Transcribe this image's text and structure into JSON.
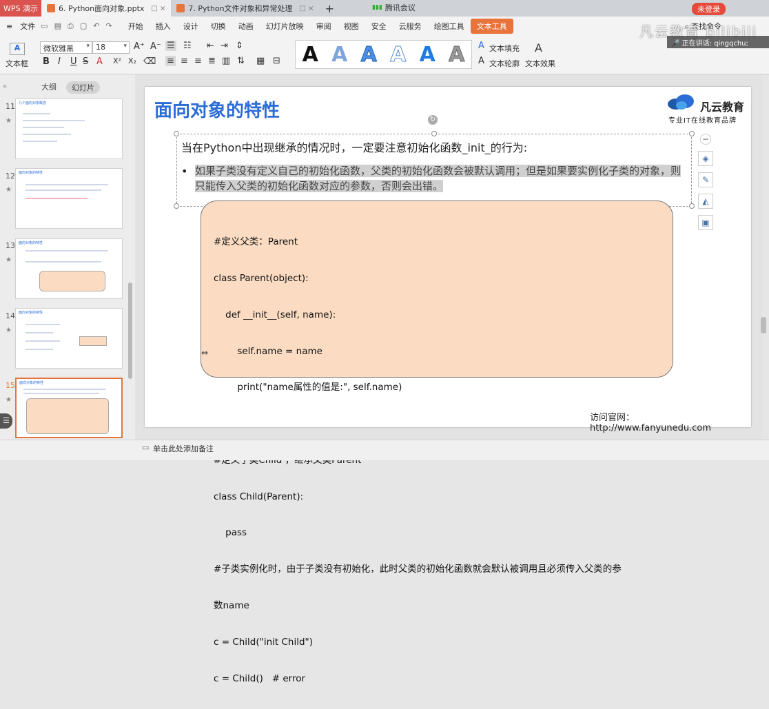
{
  "titlebar": {
    "app_tab": "WPS 演示",
    "tabs": [
      {
        "label": "6. Python面向对象.pptx"
      },
      {
        "label": "7. Python文件对象和异常处理"
      }
    ],
    "meeting": "腾讯会议",
    "login": "未登录"
  },
  "menubar": {
    "file": "文件",
    "items": [
      "开始",
      "插入",
      "设计",
      "切换",
      "动画",
      "幻灯片放映",
      "审阅",
      "视图",
      "安全",
      "云服务",
      "绘图工具",
      "文本工具"
    ],
    "active": "文本工具"
  },
  "ribbon": {
    "textbox_label": "文本框",
    "font_name": "微软雅黑",
    "font_size": "18",
    "text_fill": "文本填充",
    "text_outline": "文本轮廓",
    "text_effect": "文本效果",
    "search": "查找命令"
  },
  "left_panel": {
    "tab_outline": "大纲",
    "tab_slides": "幻灯片",
    "slide_numbers": [
      "11",
      "12",
      "13",
      "14",
      "15"
    ],
    "slide_titles": [
      "几个面向对象概念",
      "面向对象的特性",
      "面向对象的特性",
      "面向对象的特性",
      "面向对象的特性"
    ]
  },
  "slide": {
    "title": "面向对象的特性",
    "logo_name": "凡云教育",
    "logo_slogan": "专业IT在线教育品牌",
    "intro": "当在Python中出现继承的情况时，一定要注意初始化函数_init_的行为:",
    "bullet": "如果子类没有定义自己的初始化函数，父类的初始化函数会被默认调用；但是如果要实例化子类的对象，则只能传入父类的初始化函数对应的参数，否则会出错。",
    "code_lines": [
      "#定义父类：Parent",
      "class Parent(object):",
      "    def __init__(self, name):",
      "        self.name = name",
      "        print(\"name属性的值是:\", self.name)",
      "",
      "#定义子类Child ，继承父类Parent",
      "class Child(Parent):",
      "    pass",
      "#子类实例化时，由于子类没有初始化，此时父类的初始化函数就会默认被调用且必须传入父类的参",
      "数name",
      "c = Child(\"init Child\")",
      "c = Child()   # error"
    ],
    "footer": "访问官网：http://www.fanyunedu.com"
  },
  "status": {
    "note": "单击此处添加备注"
  },
  "overlay": {
    "watermark": "凡云教育 bilibili",
    "speaking": "正在讲话: qingqchu;"
  },
  "colors": {
    "accent": "#e8743b",
    "title_blue": "#2b6cd6",
    "code_bg": "#fbdcc3"
  }
}
